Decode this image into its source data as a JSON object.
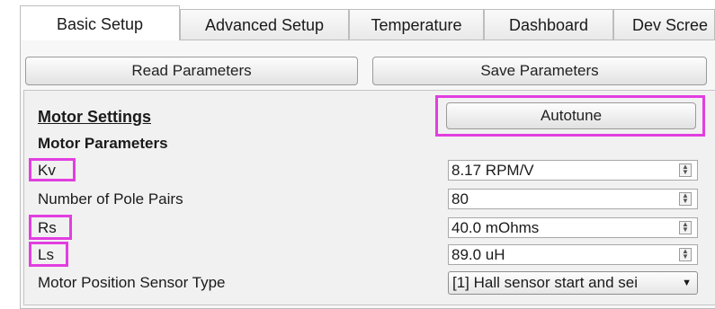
{
  "tabs": [
    {
      "label": "Basic Setup",
      "active": true
    },
    {
      "label": "Advanced Setup",
      "active": false
    },
    {
      "label": "Temperature",
      "active": false
    },
    {
      "label": "Dashboard",
      "active": false
    },
    {
      "label": "Dev Scree",
      "active": false
    }
  ],
  "toolbar": {
    "read_label": "Read Parameters",
    "save_label": "Save Parameters"
  },
  "motor_settings": {
    "title": "Motor Settings",
    "autotune_label": "Autotune",
    "parameters_title": "Motor Parameters",
    "rows": [
      {
        "label": "Kv",
        "value": "8.17 RPM/V",
        "highlighted": true
      },
      {
        "label": "Number of Pole Pairs",
        "value": "80",
        "highlighted": false
      },
      {
        "label": "Rs",
        "value": "40.0 mOhms",
        "highlighted": true
      },
      {
        "label": "Ls",
        "value": "89.0 uH",
        "highlighted": true
      }
    ],
    "sensor": {
      "label": "Motor Position Sensor Type",
      "selected": "[1] Hall sensor start and sei"
    }
  },
  "colors": {
    "highlight": "#e23ee0"
  },
  "icons": {
    "spin": "up-down-spin-arrows-icon",
    "dropdown": "chevron-down-icon"
  }
}
